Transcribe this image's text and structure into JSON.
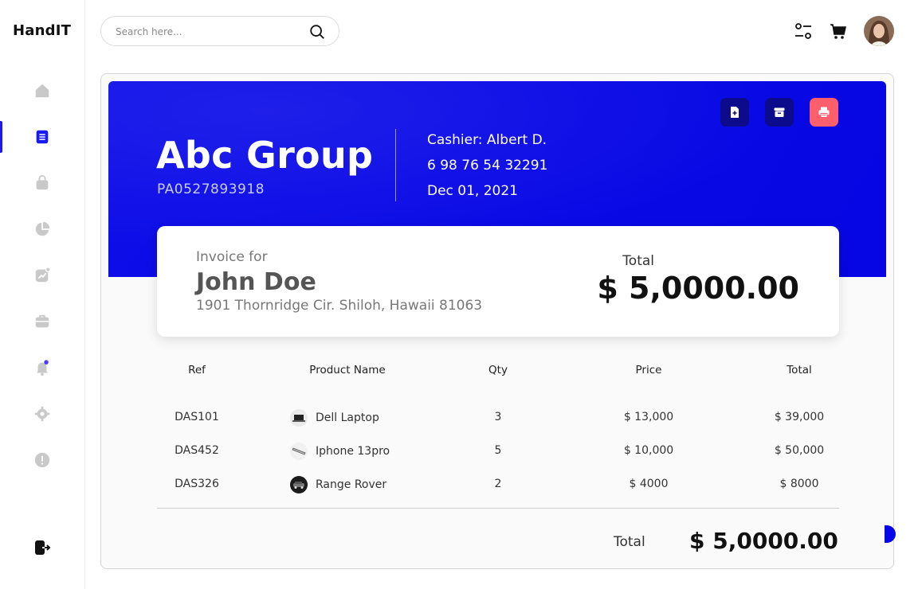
{
  "app": {
    "brand": "HandIT"
  },
  "search": {
    "placeholder": "Search here..."
  },
  "colors": {
    "accent": "#0606e8",
    "accent_dark": "#0b0b8c",
    "print_red": "#ff5f6d"
  },
  "sidebar": {
    "items": [
      {
        "icon": "home-icon",
        "active": false
      },
      {
        "icon": "document-icon",
        "active": true
      },
      {
        "icon": "bag-icon",
        "active": false
      },
      {
        "icon": "pie-chart-icon",
        "active": false
      },
      {
        "icon": "trend-chart-icon",
        "active": false
      },
      {
        "icon": "briefcase-icon",
        "active": false
      },
      {
        "icon": "bell-icon",
        "active": false
      },
      {
        "icon": "gear-icon",
        "active": false
      },
      {
        "icon": "alert-icon",
        "active": false
      }
    ],
    "logout_icon": "logout-icon"
  },
  "topbar": {
    "icons": [
      "filter-icon",
      "cart-icon"
    ],
    "avatar": "user-avatar"
  },
  "invoice": {
    "company": "Abc Group",
    "company_id": "PA0527893918",
    "cashier": "Cashier:  Albert D.",
    "phone": "6 98 76 54 32291",
    "date": "Dec 01, 2021",
    "actions": [
      "add-file-icon",
      "archive-icon",
      "printer-icon"
    ],
    "bill_to": {
      "label": "Invoice for",
      "name": "John Doe",
      "address": "1901 Thornridge Cir. Shiloh, Hawaii 81063"
    },
    "total_label": "Total",
    "total_value": "$ 5,0000.00",
    "table": {
      "headers": {
        "ref": "Ref",
        "product": "Product  Name",
        "qty": "Qty",
        "price": "Price",
        "total": "Total"
      },
      "rows": [
        {
          "ref": "DAS101",
          "product": "Dell Laptop",
          "icon": "laptop-icon",
          "qty": "3",
          "price": "$ 13,000",
          "total": "$ 39,000"
        },
        {
          "ref": "DAS452",
          "product": "Iphone 13pro",
          "icon": "phone-icon",
          "qty": "5",
          "price": "$ 10,000",
          "total": "$ 50,000"
        },
        {
          "ref": "DAS326",
          "product": "Range Rover",
          "icon": "car-icon",
          "qty": "2",
          "price": "$ 4000",
          "total": "$ 8000"
        }
      ]
    },
    "footer": {
      "label": "Total",
      "value": "$ 5,0000.00"
    }
  }
}
